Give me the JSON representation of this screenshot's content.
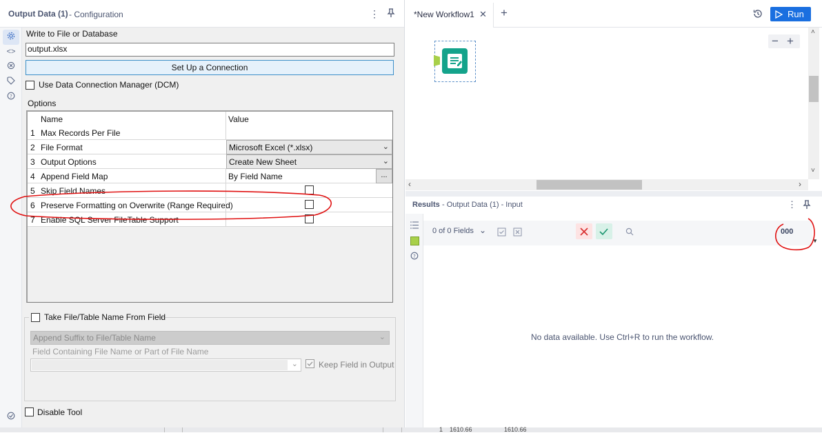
{
  "left_panel": {
    "title": "Output Data (1)",
    "subtitle": "- Configuration",
    "write_label": "Write to File or Database",
    "file_value": "output.xlsx",
    "setup_button": "Set Up a Connection",
    "dcm_label": "Use Data Connection Manager (DCM)",
    "options_label": "Options",
    "grid_headers": {
      "name": "Name",
      "value": "Value"
    },
    "rows": [
      {
        "num": "1",
        "name": "Max Records Per File",
        "value": ""
      },
      {
        "num": "2",
        "name": "File Format",
        "value": "Microsoft Excel (*.xlsx)"
      },
      {
        "num": "3",
        "name": "Output Options",
        "value": "Create New Sheet"
      },
      {
        "num": "4",
        "name": "Append Field Map",
        "value": "By Field Name",
        "button": "..."
      },
      {
        "num": "5",
        "name": "Skip Field Names",
        "value": ""
      },
      {
        "num": "6",
        "name": "Preserve Formatting on Overwrite (Range Required)",
        "value": ""
      },
      {
        "num": "7",
        "name": "Enable SQL Server FileTable Support",
        "value": ""
      }
    ],
    "take_name_label": "Take File/Table Name From Field",
    "append_suffix": "Append Suffix to File/Table Name",
    "field_containing_label": "Field Containing File Name or Part of File Name",
    "keep_field_label": "Keep Field in Output",
    "disable_tool_label": "Disable Tool"
  },
  "workflow": {
    "tab_title": "*New Workflow1",
    "run_label": "Run",
    "zoom_out": "−",
    "zoom_in": "+"
  },
  "results": {
    "title": "Results",
    "subtitle": "- Output Data (1) - Input",
    "fields_label": "0 of 0 Fields",
    "format_value": "000",
    "empty_message": "No data available. Use Ctrl+R to run the workflow."
  },
  "bottom_strip": {
    "row_num": "1",
    "val_1": "1610.66",
    "val_2": "1610.66"
  },
  "colors": {
    "accent": "#1a6fe0",
    "annotation": "#e01010",
    "tool_teal": "#14a38b"
  }
}
